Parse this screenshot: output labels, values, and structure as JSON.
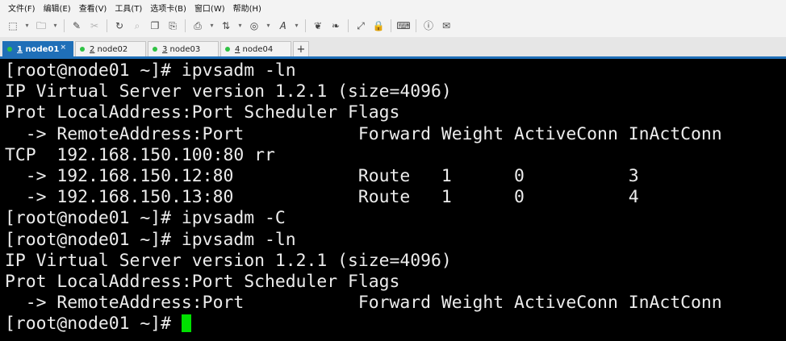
{
  "menubar": {
    "items": [
      "文件(F)",
      "编辑(E)",
      "查看(V)",
      "工具(T)",
      "选项卡(B)",
      "窗口(W)",
      "帮助(H)"
    ]
  },
  "toolbar": {
    "icons": [
      "new-session-icon",
      "open-folder-icon",
      "pencil-icon",
      "disconnect-icon",
      "reconnect-icon",
      "find-icon",
      "copy-icon",
      "paste-icon",
      "print-icon",
      "transfer-icon",
      "globe-icon",
      "font-icon",
      "script-icon",
      "xftp-icon",
      "fullscreen-icon",
      "lock-icon",
      "keyboard-icon",
      "help-icon",
      "chat-icon"
    ]
  },
  "tabs": [
    {
      "number": "1",
      "label": " node01",
      "active": true
    },
    {
      "number": "2",
      "label": " node02",
      "active": false
    },
    {
      "number": "3",
      "label": " node03",
      "active": false
    },
    {
      "number": "4",
      "label": " node04",
      "active": false
    }
  ],
  "tab_add_label": "+",
  "terminal": {
    "lines": [
      "[root@node01 ~]# ipvsadm -ln",
      "IP Virtual Server version 1.2.1 (size=4096)",
      "Prot LocalAddress:Port Scheduler Flags",
      "  -> RemoteAddress:Port           Forward Weight ActiveConn InActConn",
      "TCP  192.168.150.100:80 rr",
      "  -> 192.168.150.12:80            Route   1      0          3",
      "  -> 192.168.150.13:80            Route   1      0          4",
      "[root@node01 ~]# ipvsadm -C",
      "[root@node01 ~]# ipvsadm -ln",
      "IP Virtual Server version 1.2.1 (size=4096)",
      "Prot LocalAddress:Port Scheduler Flags",
      "  -> RemoteAddress:Port           Forward Weight ActiveConn InActConn"
    ],
    "prompt": "[root@node01 ~]# "
  },
  "colors": {
    "terminal_bg": "#000000",
    "terminal_fg": "#ececec",
    "cursor": "#00e000",
    "active_tab": "#1f6fb8",
    "session_dot": "#2fc244"
  }
}
